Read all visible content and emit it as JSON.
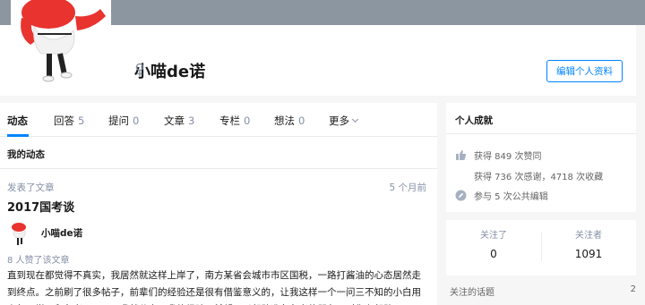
{
  "profile": {
    "name": "小喵de诺",
    "edit_label": "编辑个人资料"
  },
  "tabs": [
    {
      "label": "动态",
      "count": ""
    },
    {
      "label": "回答",
      "count": "5"
    },
    {
      "label": "提问",
      "count": "0"
    },
    {
      "label": "文章",
      "count": "3"
    },
    {
      "label": "专栏",
      "count": "0"
    },
    {
      "label": "想法",
      "count": "0"
    },
    {
      "label": "更多",
      "count": ""
    }
  ],
  "feed": {
    "section_title": "我的动态",
    "meta": "发表了文章",
    "time": "5 个月前",
    "article_title": "2017国考谈",
    "author": "小喵de诺",
    "likes": "8 人赞了该文章",
    "excerpt": "直到现在都觉得不真实，我居然就这样上岸了，南方某省会城市市区国税，一路打酱油的心态居然走到终点。之前刷了很多帖子，前辈们的经验还是很有借鉴意义的，让我这样一个一问三不知的小白用上午了学习和备考，下面，我就分享下我的经验，希望可以帮助准备备考的朋友，对你有帮助"
  },
  "achievements": {
    "title": "个人成就",
    "likes": "获得 849 次赞同",
    "thanks": "获得 736 次感谢，4718 次收藏",
    "edits": "参与 5 次公共编辑"
  },
  "follow": {
    "following_label": "关注了",
    "following_count": "0",
    "followers_label": "关注者",
    "followers_count": "1091"
  },
  "topics": {
    "label": "关注的话题",
    "count": "2"
  },
  "colors": {
    "accent": "#0084ff",
    "cover": "#8c96a1",
    "muted": "#8590a6"
  }
}
